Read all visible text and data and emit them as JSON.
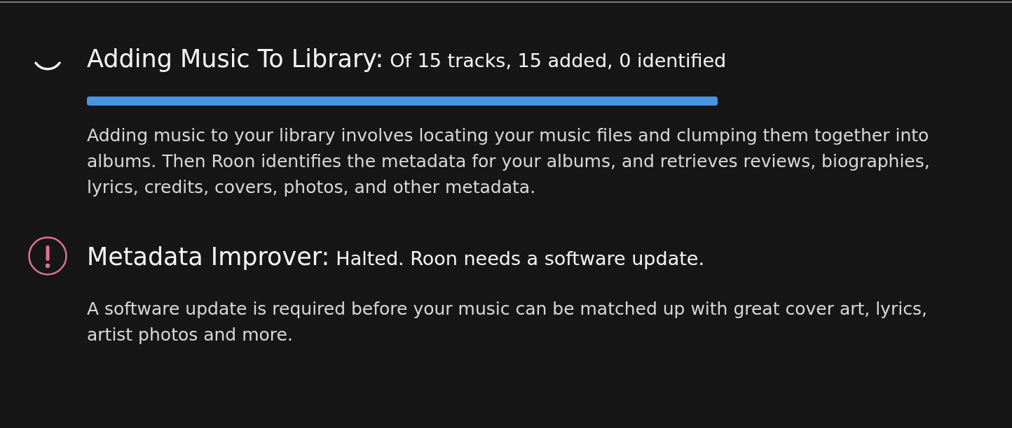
{
  "tasks": [
    {
      "kind": "progress",
      "title": "Adding Music To Library:",
      "status": "Of 15 tracks, 15 added, 0 identified",
      "level": 1,
      "description": "Adding music to your library involves locating your music files and clumping them together into albums. Then Roon identifies the metadata for your albums, and retrieves reviews, biographies, lyrics, credits, covers, photos, and other metadata."
    },
    {
      "kind": "alert",
      "title": "Metadata Improver:",
      "status": "Halted. Roon needs a software update.",
      "description": "A software update is required before your music can be matched up with great cover art, lyrics, artist photos and more."
    }
  ]
}
